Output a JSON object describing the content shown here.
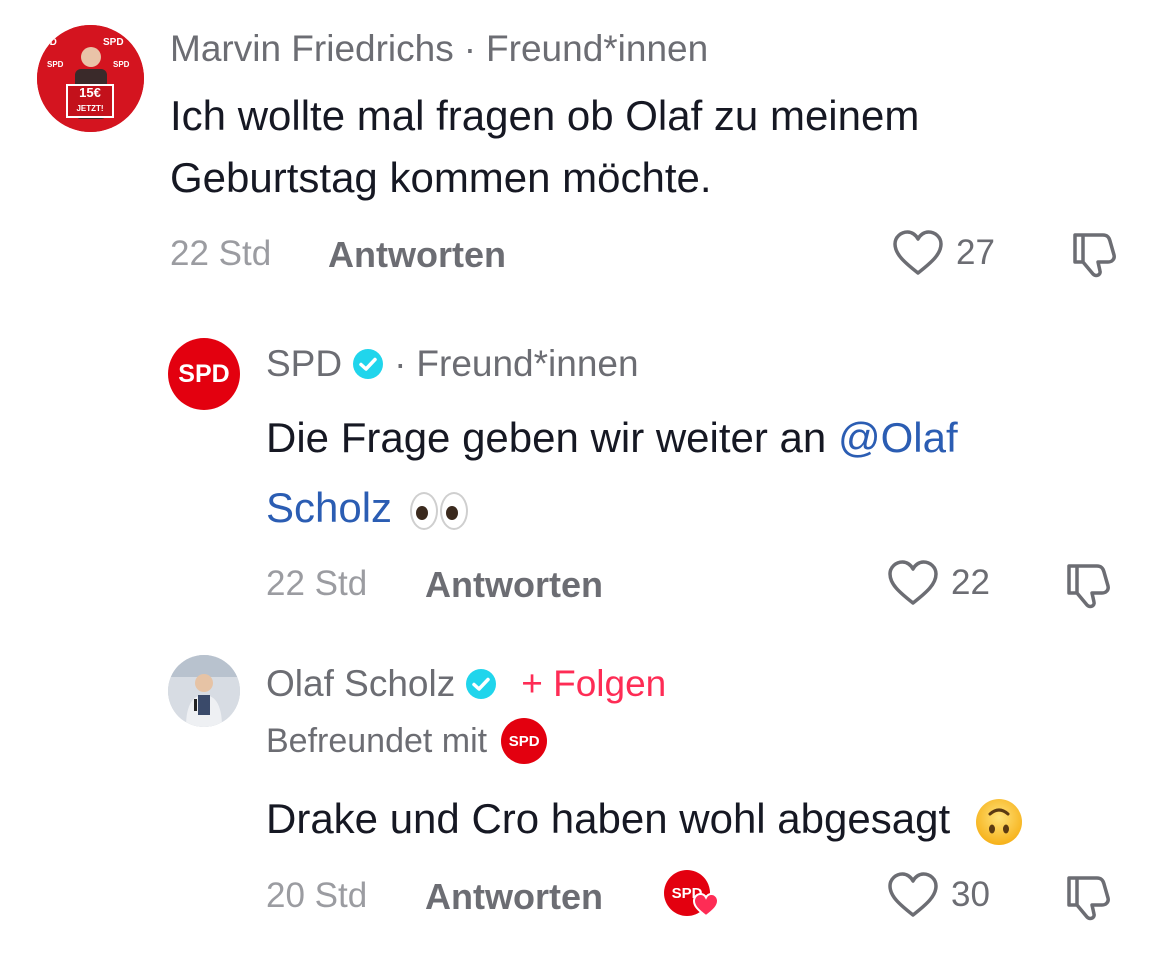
{
  "comments": [
    {
      "username": "Marvin Friedrichs",
      "relation": "Freund*innen",
      "avatar_text": {
        "price": "15€",
        "sub": "JETZT!"
      },
      "text": "Ich wollte mal fragen ob Olaf zu meinem Geburtstag kommen möchte.",
      "time": "22 Std",
      "reply_label": "Antworten",
      "likes": "27"
    },
    {
      "username": "SPD",
      "avatar_text": "SPD",
      "verified": true,
      "relation": "Freund*innen",
      "text_before": "Die Frage geben wir weiter an",
      "mention": "@Olaf Scholz",
      "time": "22 Std",
      "reply_label": "Antworten",
      "likes": "22"
    },
    {
      "username": "Olaf Scholz",
      "verified": true,
      "follow_label": "+ Folgen",
      "friends_with_label": "Befreundet mit",
      "friends_with_badge": "SPD",
      "text": "Drake und Cro haben wohl abgesagt",
      "time": "20 Std",
      "reply_label": "Antworten",
      "liked_by_badge": "SPD",
      "likes": "30"
    }
  ],
  "colors": {
    "spd_red": "#e3000f",
    "mention_blue": "#2b5db3",
    "follow_pink": "#fe2c55",
    "verified_cyan": "#20d5ec"
  },
  "icons": [
    "heart-outline-icon",
    "thumbs-down-icon",
    "verified-badge-icon",
    "upside-down-face-emoji",
    "eyes-emoji"
  ]
}
